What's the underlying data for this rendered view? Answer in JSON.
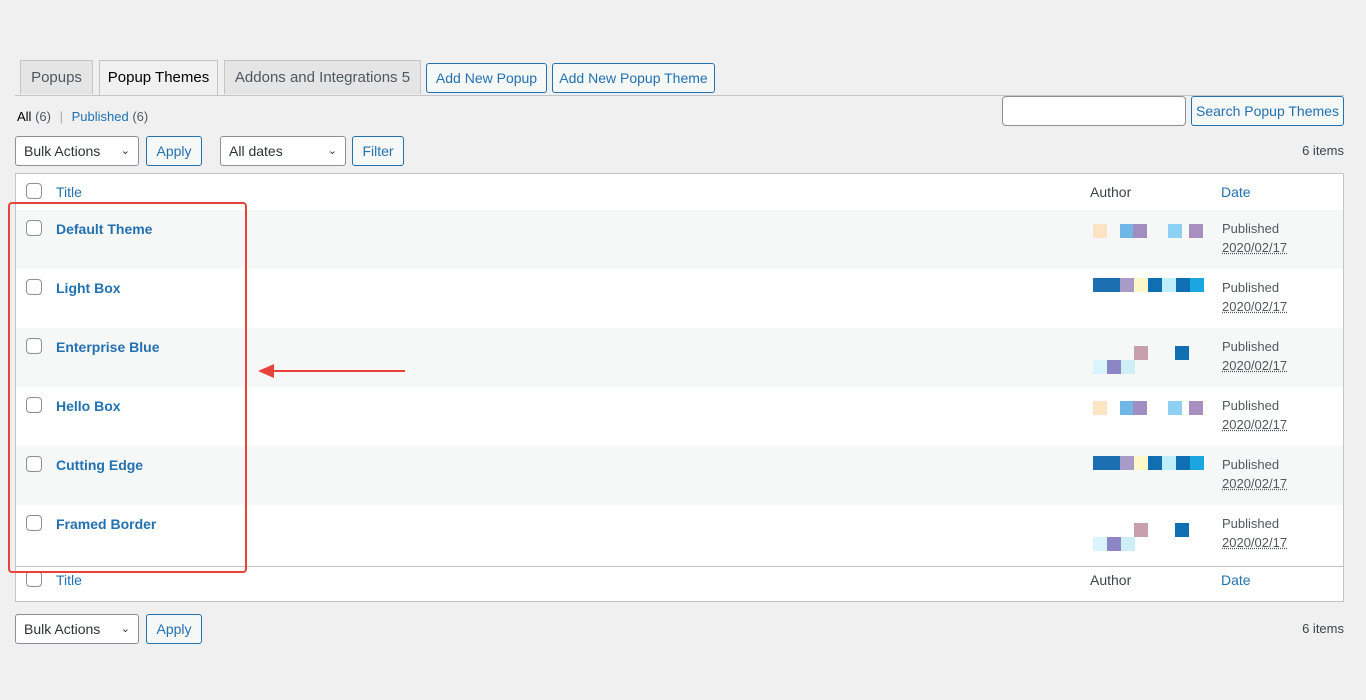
{
  "tabs": [
    {
      "label": "Popups",
      "active": false
    },
    {
      "label": "Popup Themes",
      "active": true
    },
    {
      "label": "Addons and Integrations 5",
      "active": false
    }
  ],
  "actions": {
    "add_popup": "Add New Popup",
    "add_theme": "Add New Popup Theme"
  },
  "views": {
    "all_label": "All",
    "all_count": "(6)",
    "separator": "|",
    "published_label": "Published",
    "published_count": "(6)"
  },
  "search": {
    "placeholder": "",
    "button": "Search Popup Themes"
  },
  "toolbar_top": {
    "bulk_actions": "Bulk Actions",
    "apply": "Apply",
    "dates": "All dates",
    "filter": "Filter",
    "items": "6 items"
  },
  "table": {
    "columns": {
      "title": "Title",
      "author": "Author",
      "date": "Date"
    },
    "rows": [
      {
        "title": "Default Theme",
        "status": "Published",
        "date": "2020/02/17"
      },
      {
        "title": "Light Box",
        "status": "Published",
        "date": "2020/02/17"
      },
      {
        "title": "Enterprise Blue",
        "status": "Published",
        "date": "2020/02/17"
      },
      {
        "title": "Hello Box",
        "status": "Published",
        "date": "2020/02/17"
      },
      {
        "title": "Cutting Edge",
        "status": "Published",
        "date": "2020/02/17"
      },
      {
        "title": "Framed Border",
        "status": "Published",
        "date": "2020/02/17"
      }
    ]
  },
  "toolbar_bottom": {
    "bulk_actions": "Bulk Actions",
    "apply": "Apply",
    "items": "6 items"
  },
  "colors": {
    "link": "#2271b1",
    "annotation": "#e8433a"
  }
}
